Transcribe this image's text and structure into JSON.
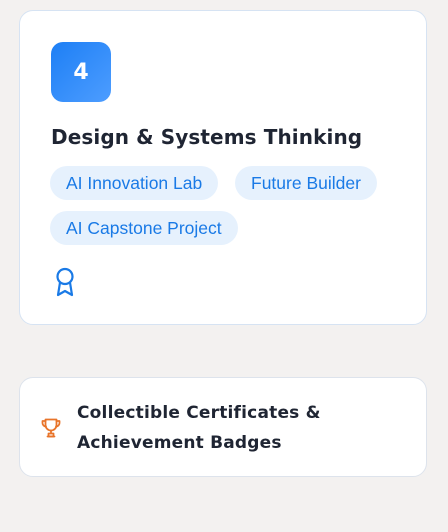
{
  "step_card": {
    "step_number": "4",
    "title": "Design & Systems Thinking",
    "tags": [
      "AI Innovation Lab",
      "Future Builder",
      "AI Capstone Project"
    ],
    "icon": "award-ribbon-icon",
    "accent_color": "#1d7ff5"
  },
  "feature_card": {
    "icon": "trophy-icon",
    "icon_color": "#e8742a",
    "text": "Collectible Certificates & Achievement Badges"
  }
}
